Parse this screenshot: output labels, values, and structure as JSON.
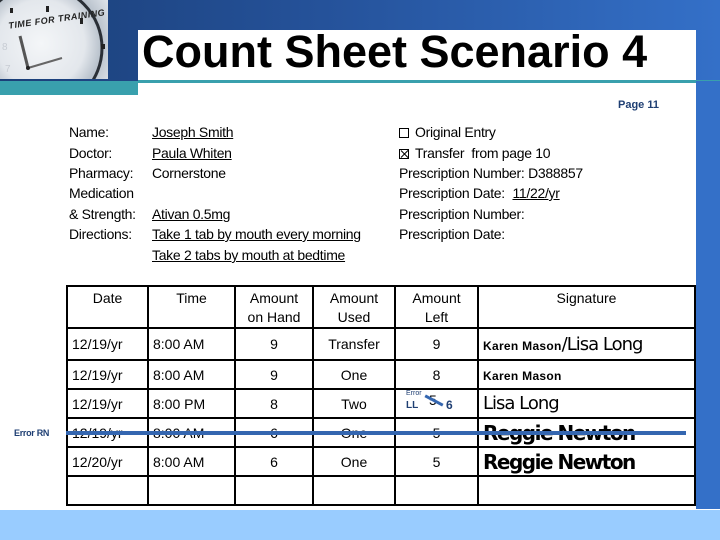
{
  "header": {
    "logo_text": "TIME FOR TRAINING",
    "title": "Count Sheet Scenario 4",
    "page_label": "Page 11"
  },
  "patient_info": {
    "name_label": "Name:",
    "name_value": "Joseph Smith",
    "doctor_label": "Doctor:",
    "doctor_value": "Paula Whiten",
    "pharmacy_label": "Pharmacy:",
    "pharmacy_value": "Cornerstone",
    "medication_label": "Medication",
    "strength_label": "& Strength:",
    "strength_value": "Ativan 0.5mg",
    "directions_label": "Directions:",
    "directions_line1": "Take 1 tab by mouth every morning",
    "directions_line2": "Take 2 tabs by mouth at bedtime"
  },
  "entry_info": {
    "original_entry_label": "Original Entry",
    "original_entry_checked": false,
    "transfer_label": "Transfer  from page 10",
    "transfer_checked": true,
    "rx_number_label": "Prescription Number:",
    "rx_number_value": "D388857",
    "rx_date_label": "Prescription Date:",
    "rx_date_value": "11/22/yr",
    "rx_number2_label": "Prescription Number:",
    "rx_date2_label": "Prescription Date:"
  },
  "table": {
    "headers": [
      "Date",
      "Time",
      "Amount\non Hand",
      "Amount\nUsed",
      "Amount\nLeft",
      "Signature"
    ],
    "header_lines": [
      [
        "Date",
        ""
      ],
      [
        "Time",
        ""
      ],
      [
        "Amount",
        "on Hand"
      ],
      [
        "Amount",
        "Used"
      ],
      [
        "Amount",
        "Left"
      ],
      [
        "Signature",
        ""
      ]
    ],
    "rows": [
      {
        "date": "12/19/yr",
        "time": "8:00 AM",
        "on_hand": "9",
        "used": "Transfer",
        "left": "9",
        "signature_print": "Karen Mason",
        "signature_hand": "/Lisa Long"
      },
      {
        "date": "12/19/yr",
        "time": "8:00 AM",
        "on_hand": "9",
        "used": "One",
        "left": "8",
        "signature_print": "Karen Mason",
        "signature_hand": ""
      },
      {
        "date": "12/19/yr",
        "time": "8:00 PM",
        "on_hand": "8",
        "used": "Two",
        "left": "5",
        "left_correction": "6",
        "error_note": "Error",
        "error_initial": "LL",
        "signature_print": "",
        "signature_hand": "Lisa Long"
      },
      {
        "date": "12/19/yr",
        "time": "8:00 AM",
        "on_hand": "6",
        "used": "One",
        "left": "5",
        "signature_print": "",
        "signature_hand": "Reggie Newton",
        "struck_through": true
      },
      {
        "date": "12/20/yr",
        "time": "8:00 AM",
        "on_hand": "6",
        "used": "One",
        "left": "5",
        "signature_print": "",
        "signature_hand": "Reggie Newton"
      },
      {
        "date": "",
        "time": "",
        "on_hand": "",
        "used": "",
        "left": "",
        "signature_print": "",
        "signature_hand": ""
      }
    ],
    "strike_annotation": "Error RN"
  },
  "colors": {
    "header_dark": "#1b3f78",
    "header_light": "#3470c8",
    "teal": "#39a0ad",
    "bottom_band": "#99ccff",
    "annotation_blue": "#3466b0",
    "annotation_text": "#1f3f73"
  }
}
